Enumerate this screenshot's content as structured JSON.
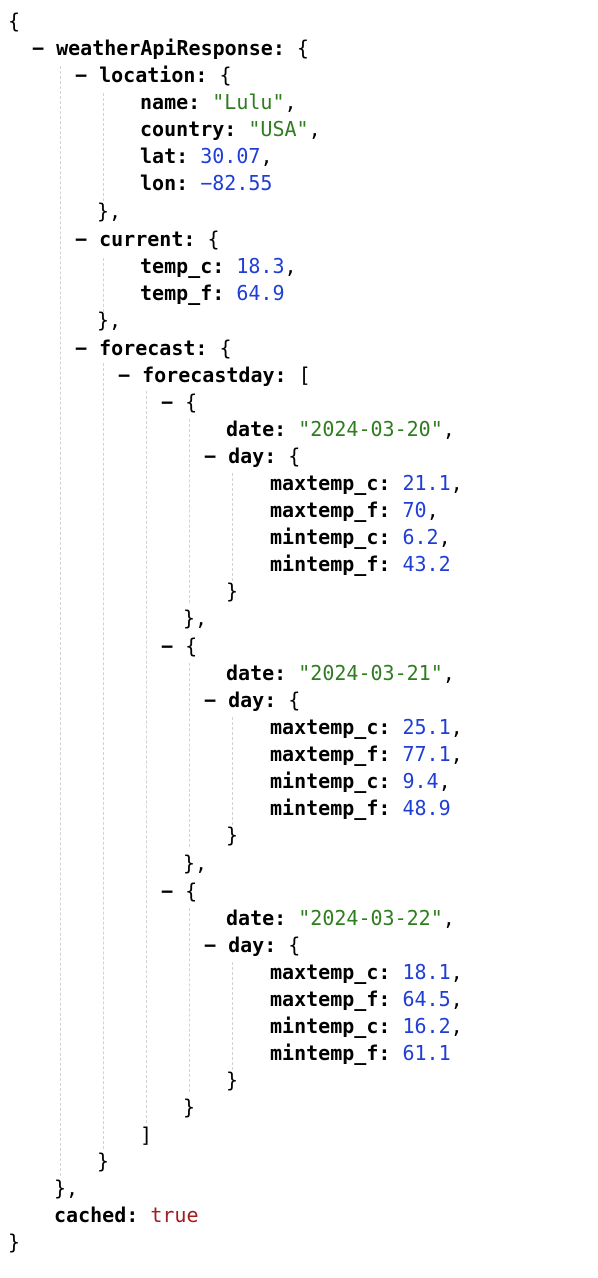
{
  "toggle_glyph": "−",
  "colors": {
    "string": "#2e7d1e",
    "number": "#1f3ed6",
    "boolean": "#a31d1d",
    "guide": "#d2d2d2"
  },
  "root": {
    "weatherApiResponse": {
      "key": "weatherApiResponse",
      "location": {
        "key": "location",
        "name": {
          "key": "name",
          "value": "\"Lulu\""
        },
        "country": {
          "key": "country",
          "value": "\"USA\""
        },
        "lat": {
          "key": "lat",
          "value": "30.07"
        },
        "lon": {
          "key": "lon",
          "value": "−82.55"
        }
      },
      "current": {
        "key": "current",
        "temp_c": {
          "key": "temp_c",
          "value": "18.3"
        },
        "temp_f": {
          "key": "temp_f",
          "value": "64.9"
        }
      },
      "forecast": {
        "key": "forecast",
        "forecastday": {
          "key": "forecastday",
          "items": [
            {
              "date": {
                "key": "date",
                "value": "\"2024-03-20\""
              },
              "day": {
                "key": "day",
                "maxtemp_c": {
                  "key": "maxtemp_c",
                  "value": "21.1"
                },
                "maxtemp_f": {
                  "key": "maxtemp_f",
                  "value": "70"
                },
                "mintemp_c": {
                  "key": "mintemp_c",
                  "value": "6.2"
                },
                "mintemp_f": {
                  "key": "mintemp_f",
                  "value": "43.2"
                }
              }
            },
            {
              "date": {
                "key": "date",
                "value": "\"2024-03-21\""
              },
              "day": {
                "key": "day",
                "maxtemp_c": {
                  "key": "maxtemp_c",
                  "value": "25.1"
                },
                "maxtemp_f": {
                  "key": "maxtemp_f",
                  "value": "77.1"
                },
                "mintemp_c": {
                  "key": "mintemp_c",
                  "value": "9.4"
                },
                "mintemp_f": {
                  "key": "mintemp_f",
                  "value": "48.9"
                }
              }
            },
            {
              "date": {
                "key": "date",
                "value": "\"2024-03-22\""
              },
              "day": {
                "key": "day",
                "maxtemp_c": {
                  "key": "maxtemp_c",
                  "value": "18.1"
                },
                "maxtemp_f": {
                  "key": "maxtemp_f",
                  "value": "64.5"
                },
                "mintemp_c": {
                  "key": "mintemp_c",
                  "value": "16.2"
                },
                "mintemp_f": {
                  "key": "mintemp_f",
                  "value": "61.1"
                }
              }
            }
          ]
        }
      }
    },
    "cached": {
      "key": "cached",
      "value": "true"
    }
  }
}
